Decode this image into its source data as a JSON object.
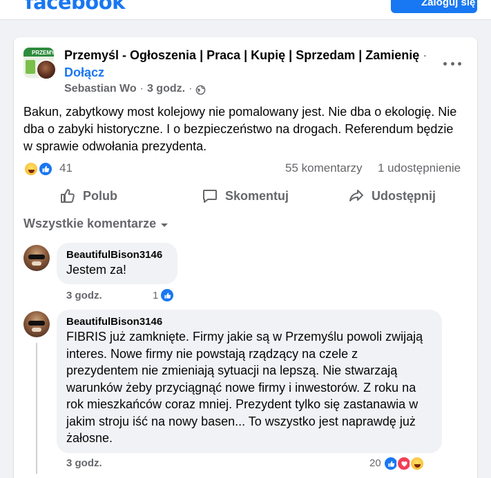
{
  "header": {
    "logo": "facebook",
    "login_button": "Zaloguj się"
  },
  "post": {
    "group_name": "Przemyśl - Ogłoszenia | Praca | Kupię | Sprzedam | Zamienię",
    "group_avatar_text": "PRZEMY",
    "separator": "·",
    "join_label": "Dołącz",
    "author": "Sebastian Wo",
    "time": "3 godz.",
    "audience_icon": "globe-icon",
    "body": "Bakun, zabytkowy most kolejowy nie pomalowany jest. Nie dba o ekologię. Nie dba o zabyki historyczne. I o bezpieczeństwo na drogach. Referendum będzie w sprawie odwołania prezydenta.",
    "reactions": [
      "haha",
      "like"
    ],
    "reaction_count": "41",
    "comments_count": "55 komentarzy",
    "shares_count": "1 udostępnienie"
  },
  "actions": {
    "like": "Polub",
    "comment": "Skomentuj",
    "share": "Udostępnij"
  },
  "comments_section": {
    "filter_label": "Wszystkie komentarze"
  },
  "comments": [
    {
      "author": "BeautifulBison3146",
      "text": "Jestem za!",
      "time": "3 godz.",
      "reaction_count": "1",
      "reactions": [
        "like"
      ]
    },
    {
      "author": "BeautifulBison3146",
      "text": "FIBRIS już zamknięte. Firmy jakie są w Przemyślu powoli zwijają interes. Nowe firmy nie powstają rządzący na czele z prezydentem nie zmieniają sytuacji na lepszą. Nie stwarzają warunków żeby przyciągnąć nowe firmy i inwestorów. Z roku na rok mieszkańców coraz mniej. Prezydent tylko się zastanawia w jakim stroju iść na nowy basen... To wszystko jest naprawdę już żałosne.",
      "time": "3 godz.",
      "reaction_count": "20",
      "reactions": [
        "like",
        "love",
        "haha"
      ]
    }
  ],
  "colors": {
    "brand": "#1877f2",
    "secondary_text": "#65676b",
    "bubble": "#f0f2f5"
  }
}
